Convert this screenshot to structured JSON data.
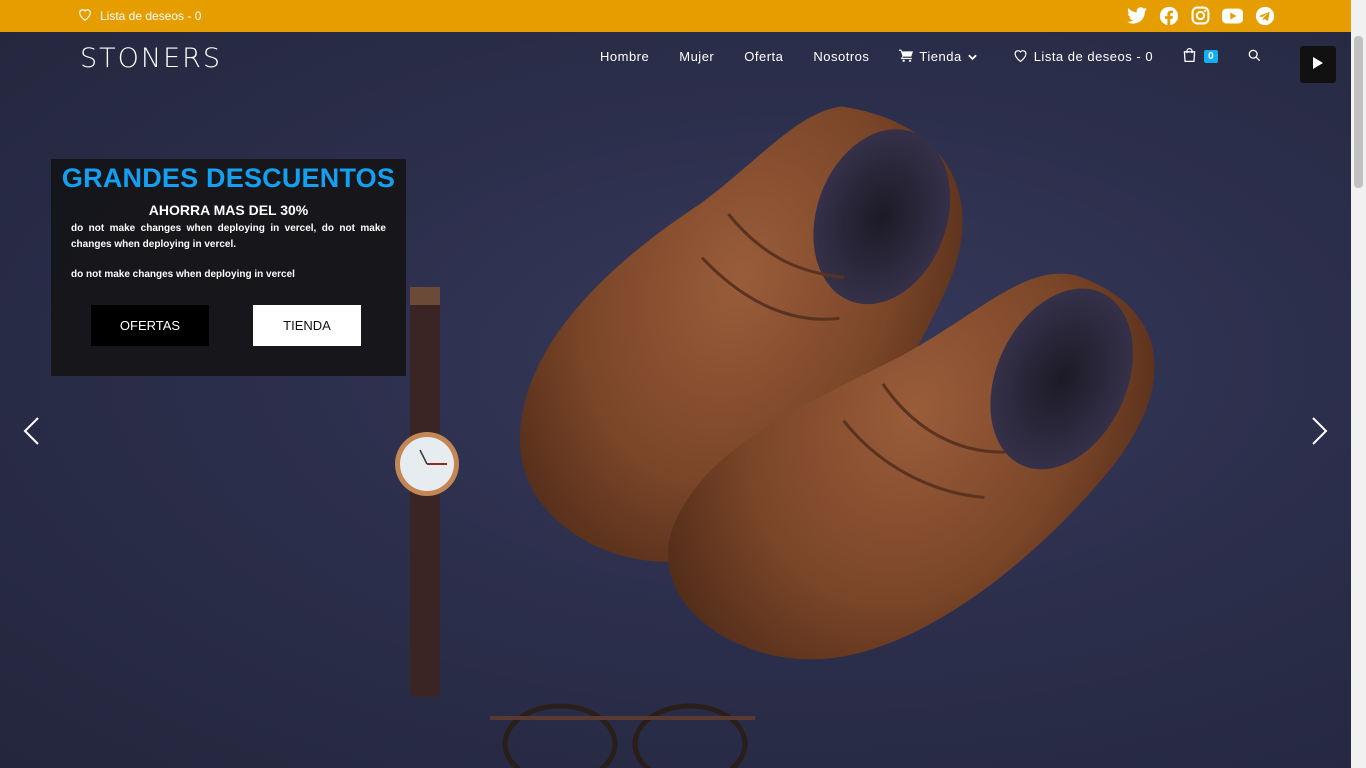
{
  "topbar": {
    "wishlist_label": "Lista de deseos - 0",
    "background": "#e69d00",
    "socials": [
      "twitter-icon",
      "facebook-icon",
      "instagram-icon",
      "youtube-icon",
      "telegram-icon"
    ]
  },
  "header": {
    "logo": "STONERS",
    "nav": [
      {
        "label": "Hombre"
      },
      {
        "label": "Mujer"
      },
      {
        "label": "Oferta"
      },
      {
        "label": "Nosotros"
      },
      {
        "label": "Tienda"
      },
      {
        "label": "Lista de deseos - 0"
      }
    ],
    "cart_count": "0",
    "accent": "#13aff0"
  },
  "hero": {
    "title": "GRANDES DESCUENTOS",
    "subtitle": "AHORRA MAS DEL 30%",
    "description": "do not make changes when deploying in vercel, do not make changes when deploying in vercel.",
    "description2": "do not make changes when deploying in vercel",
    "buttons": {
      "ofertas": "OFERTAS",
      "tienda": "TIENDA"
    }
  }
}
